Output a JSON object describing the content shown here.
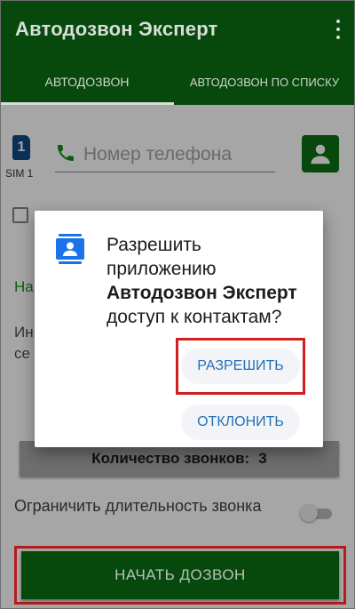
{
  "app": {
    "title": "Автодозвон Эксперт"
  },
  "tabs": [
    {
      "label": "АВТОДОЗВОН"
    },
    {
      "label": "АВТОДОЗВОН ПО СПИСКУ"
    }
  ],
  "sim": {
    "number": "1",
    "label": "SIM 1"
  },
  "phone": {
    "placeholder": "Номер телефона"
  },
  "partial": {
    "green_line": "На",
    "line1": "Ин",
    "line2": "се"
  },
  "count": {
    "label": "Количество звонков:",
    "value": "3"
  },
  "limit": {
    "label": "Ограничить длительность звонка",
    "enabled": false
  },
  "start_button": {
    "label": "НАЧАТЬ ДОЗВОН"
  },
  "dialog": {
    "line1": "Разрешить",
    "line2": "приложению",
    "app_name": "Автодозвон Эксперт",
    "line4": "доступ к контактам?",
    "allow_label": "РАЗРЕШИТЬ",
    "deny_label": "ОТКЛОНИТЬ"
  },
  "colors": {
    "primary": "#07480c",
    "highlight": "#d11e1e",
    "dialog_accent": "#2770b5"
  },
  "icons": [
    "overflow-menu-icon",
    "sim-icon",
    "phone-icon",
    "contact-icon",
    "contacts-permission-icon"
  ]
}
